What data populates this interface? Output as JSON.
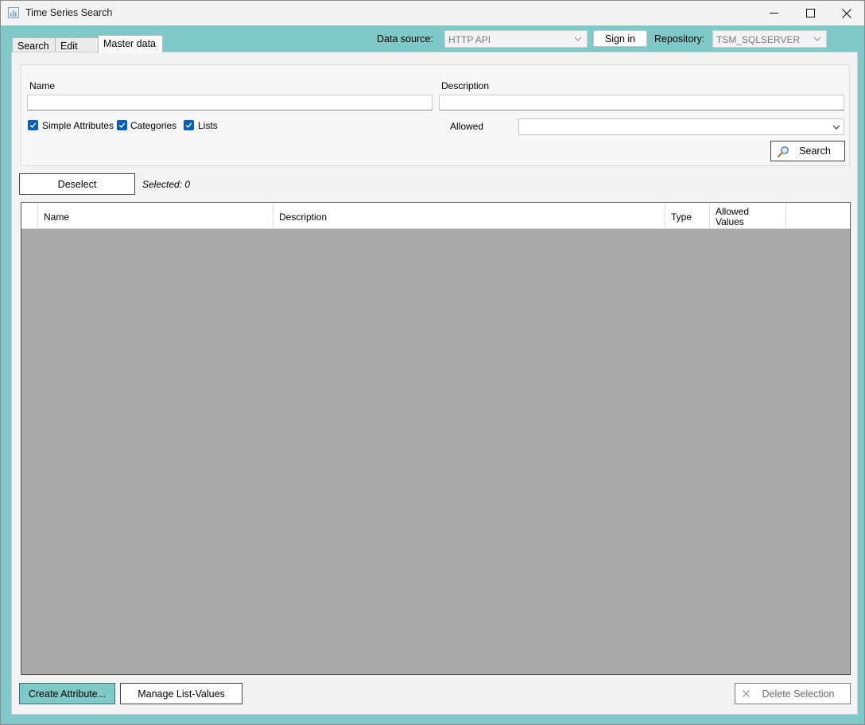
{
  "window": {
    "title": "Time Series Search"
  },
  "tabs": [
    {
      "label": "Search",
      "active": false
    },
    {
      "label": "Edit",
      "active": false
    },
    {
      "label": "Master data",
      "active": true
    }
  ],
  "toolbar": {
    "data_source_label": "Data source:",
    "data_source_value": "HTTP API",
    "sign_in_label": "Sign in",
    "repository_label": "Repository:",
    "repository_value": "TSM_SQLSERVER"
  },
  "filter": {
    "name_label": "Name",
    "name_value": "",
    "description_label": "Description",
    "description_value": "",
    "checkboxes": [
      {
        "label": "Simple Attributes",
        "checked": true
      },
      {
        "label": "Categories",
        "checked": true
      },
      {
        "label": "Lists",
        "checked": true
      }
    ],
    "allowed_label": "Allowed",
    "allowed_value": "",
    "search_label": "Search"
  },
  "selection": {
    "deselect_label": "Deselect",
    "selected_text": "Selected: 0"
  },
  "table": {
    "columns": [
      "",
      "Name",
      "Description",
      "Type",
      "Allowed Values",
      ""
    ],
    "allowed_line1": "Allowed",
    "allowed_line2": "Values",
    "rows": []
  },
  "footer": {
    "create_label": "Create Attribute...",
    "manage_label": "Manage List-Values",
    "delete_label": "Delete Selection"
  },
  "colors": {
    "accent": "#7fc9c9",
    "checkbox": "#0060c0",
    "grid_background": "#ababab"
  }
}
